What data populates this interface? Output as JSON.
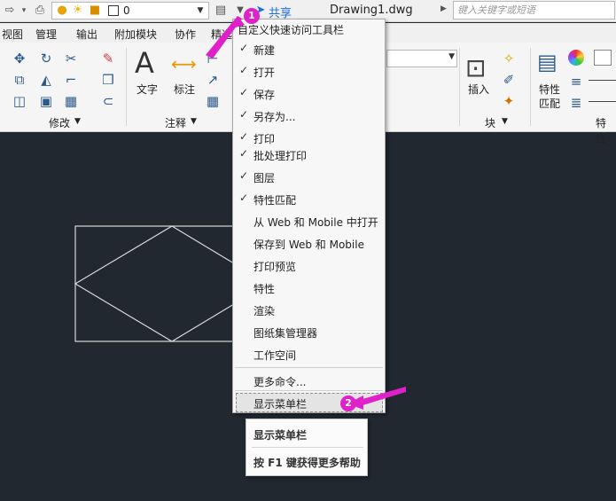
{
  "quick_access": {
    "layer_value": "0",
    "share_label": "共享",
    "drawing_title": "Drawing1.dwg",
    "search_placeholder": "键入关键字或短语"
  },
  "menubar": {
    "items": [
      "视图",
      "管理",
      "输出",
      "附加模块",
      "协作",
      "精选"
    ]
  },
  "ribbon": {
    "panels": [
      {
        "label": "修改"
      },
      {
        "label": "注释"
      },
      {
        "label": "块"
      },
      {
        "label": "特性"
      }
    ],
    "text_label": "文字",
    "dimension_label": "标注",
    "insert_label": "插入",
    "match_label_1": "特性",
    "match_label_2": "匹配"
  },
  "dropdown": {
    "title": "自定义快速访问工具栏",
    "items": [
      {
        "label": "新建",
        "checked": "✓"
      },
      {
        "label": "打开",
        "checked": "✓"
      },
      {
        "label": "保存",
        "checked": "✓"
      },
      {
        "label": "另存为...",
        "checked": "✓"
      },
      {
        "label": "打印",
        "checked": "✓"
      },
      {
        "label": "批处理打印",
        "checked": "✓"
      },
      {
        "label": "图层",
        "checked": "✓"
      },
      {
        "label": "特性匹配",
        "checked": "✓"
      },
      {
        "label": "从 Web 和 Mobile 中打开",
        "checked": ""
      },
      {
        "label": "保存到 Web 和 Mobile",
        "checked": ""
      },
      {
        "label": "打印预览",
        "checked": ""
      },
      {
        "label": "特性",
        "checked": ""
      },
      {
        "label": "渲染",
        "checked": ""
      },
      {
        "label": "图纸集管理器",
        "checked": ""
      },
      {
        "label": "工作空间",
        "checked": ""
      }
    ],
    "more_commands": "更多命令...",
    "show_menubar": "显示菜单栏"
  },
  "tooltip": {
    "title": "显示菜单栏",
    "help": "按 F1 键获得更多帮助"
  },
  "annotations": {
    "badge_1": "1",
    "badge_2": "2",
    "color": "#e020c8"
  },
  "colors": {
    "canvas_bg": "#212830",
    "drawing_lines": "#d8d8d8",
    "share_blue": "#1d6fd1"
  }
}
